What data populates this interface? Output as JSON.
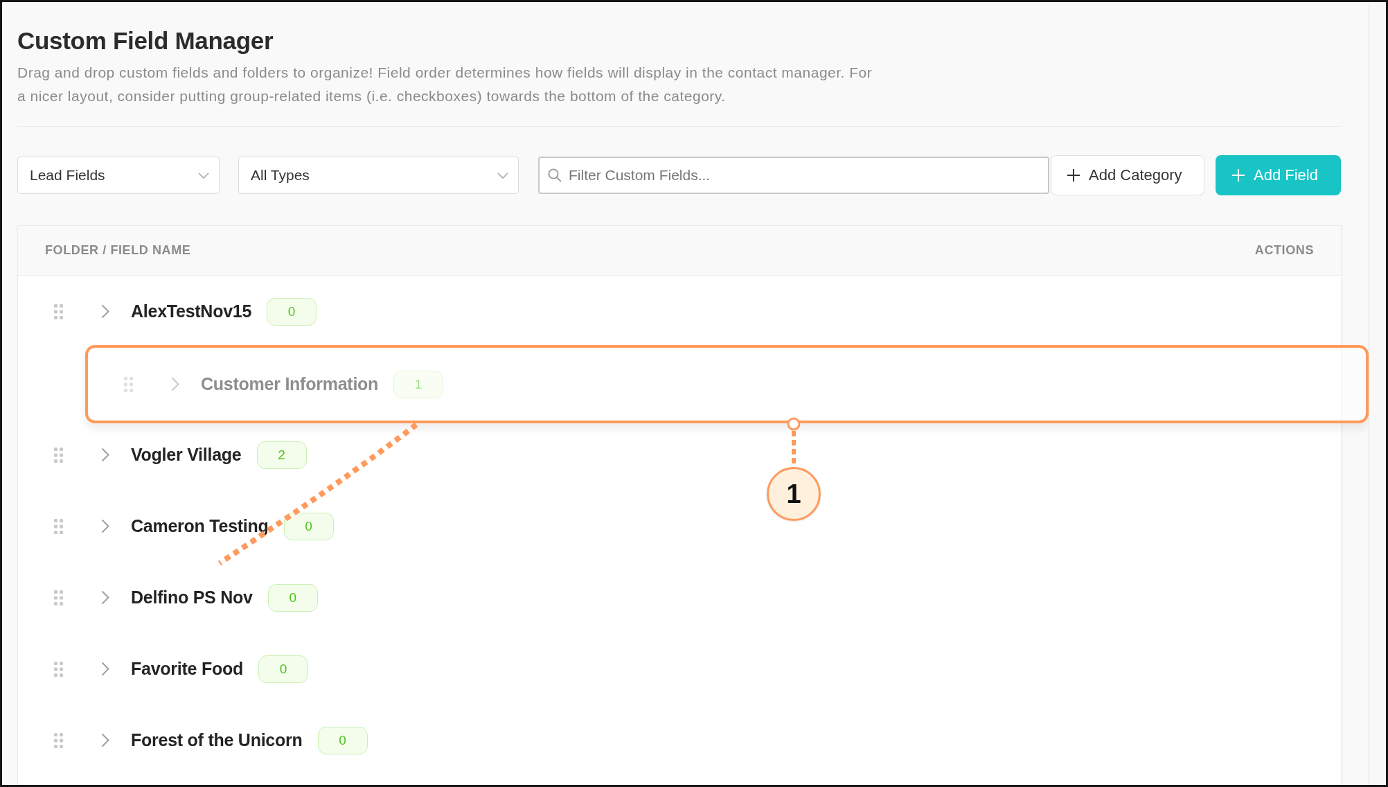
{
  "page": {
    "title": "Custom Field Manager",
    "description": "Drag and drop custom fields and folders to organize! Field order determines how fields will display in the contact manager. For a nicer layout, consider putting group-related items (i.e. checkboxes) towards the bottom of the category."
  },
  "filters": {
    "field_set": {
      "value": "Lead Fields"
    },
    "field_type": {
      "value": "All Types"
    },
    "search": {
      "placeholder": "Filter Custom Fields..."
    }
  },
  "buttons": [
    {
      "label": "Add Category",
      "kind": "outline"
    },
    {
      "label": "Add Field",
      "kind": "filled"
    }
  ],
  "table": {
    "columns": [
      "FOLDER / FIELD NAME",
      "ACTIONS"
    ],
    "rows": [
      {
        "name": "AlexTestNov15",
        "count": "0",
        "expanded": false,
        "dragging": false,
        "highlighted": false
      },
      {
        "name": "Customer Information",
        "count": "1",
        "expanded": false,
        "dragging": true,
        "highlighted": true
      },
      {
        "name": "Vogler Village",
        "count": "2",
        "expanded": false,
        "dragging": false,
        "highlighted": false
      },
      {
        "name": "Cameron Testing",
        "count": "0",
        "expanded": false,
        "dragging": false,
        "highlighted": false
      },
      {
        "name": "Delfino PS Nov",
        "count": "0",
        "expanded": false,
        "dragging": false,
        "highlighted": false
      },
      {
        "name": "Favorite Food",
        "count": "0",
        "expanded": false,
        "dragging": false,
        "highlighted": false
      },
      {
        "name": "Forest of the Unicorn",
        "count": "0",
        "expanded": false,
        "dragging": false,
        "highlighted": false
      }
    ]
  },
  "callout": {
    "number": "1"
  }
}
